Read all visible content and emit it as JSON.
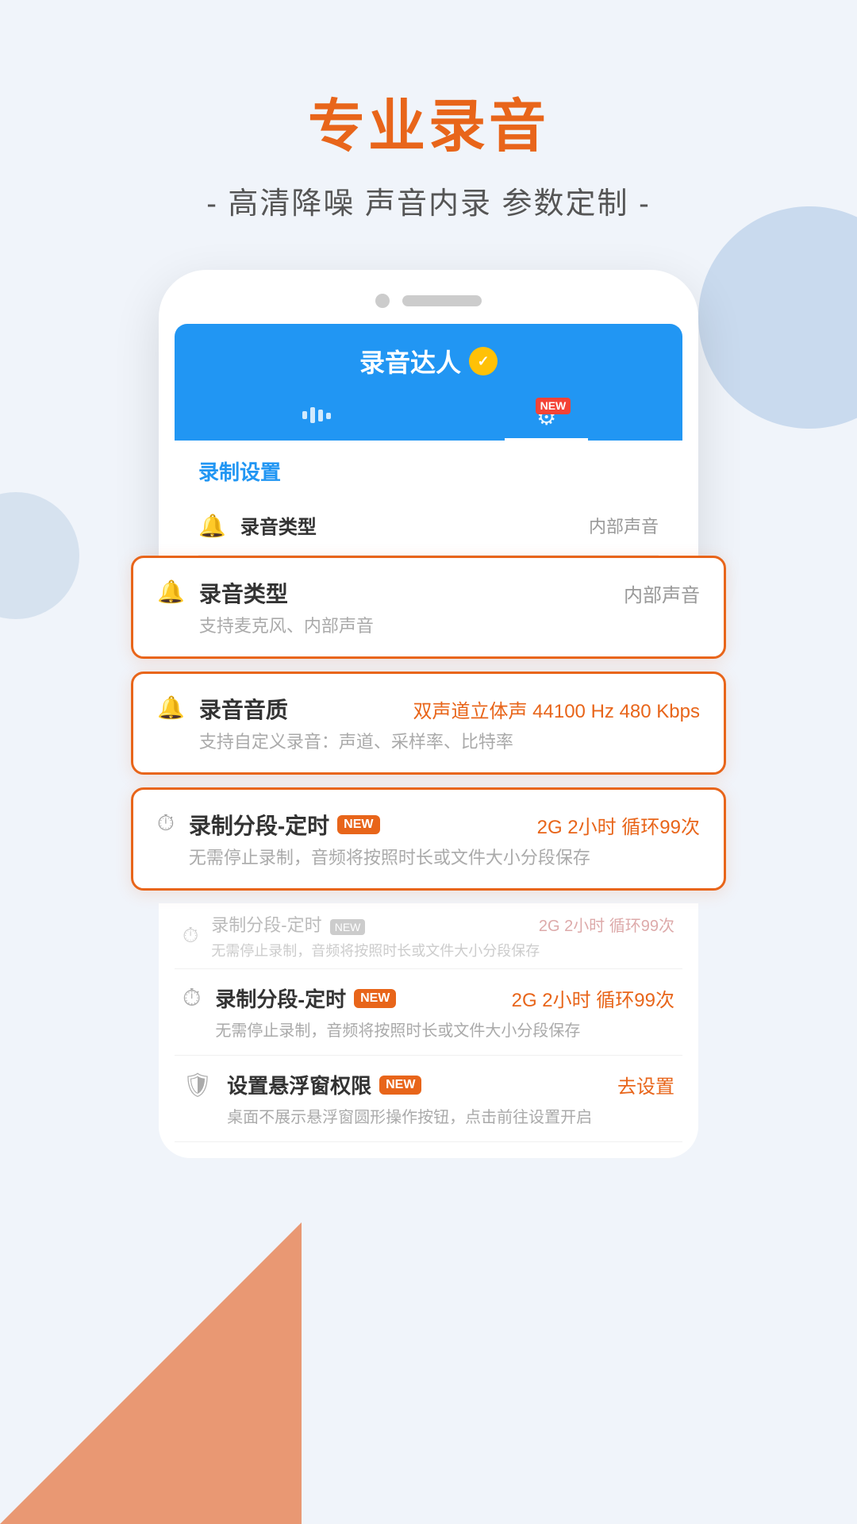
{
  "header": {
    "main_title": "专业录音",
    "sub_title": "- 高清降噪  声音内录  参数定制 -"
  },
  "phone": {
    "app_title": "录音达人",
    "app_badge": "✓",
    "tabs": [
      {
        "id": "waveform",
        "icon": "▌▌▌",
        "active": false
      },
      {
        "id": "settings",
        "icon": "⚙",
        "active": true,
        "new_badge": "NEW"
      }
    ],
    "section_title": "录制设置",
    "settings_preview": [
      {
        "icon": "🔔",
        "label": "录音类型",
        "value": "内部声音",
        "desc": ""
      }
    ]
  },
  "highlighted_cards": [
    {
      "icon": "🔔",
      "label": "录音类型",
      "value": "内部声音",
      "desc": "支持麦克风、内部声音",
      "value_orange": false
    },
    {
      "icon": "🔔",
      "label": "录音音质",
      "value": "双声道立体声 44100 Hz 480 Kbps",
      "desc": "支持自定义录音：声道、采样率、比特率",
      "value_orange": true
    },
    {
      "icon": "⏱",
      "label": "录制分段-定时",
      "has_new_tag": true,
      "value": "2G 2小时 循环99次",
      "desc": "无需停止录制，音频将按照时长或文件大小分段保存",
      "value_orange": true
    }
  ],
  "below_settings": [
    {
      "icon": "⏱",
      "label": "录制分段-定时",
      "has_new_tag": true,
      "value": "2G 2小时 循环99次",
      "desc": "无需停止录制，音频将按照时长或文件大小分段保存"
    },
    {
      "icon": "🛡",
      "label": "设置悬浮窗权限",
      "has_new_tag": true,
      "value": "去设置",
      "desc": "桌面不展示悬浮窗圆形操作按钮，点击前往设置开启"
    }
  ],
  "colors": {
    "orange": "#e8651a",
    "blue": "#2196f3",
    "light_bg": "#f0f4fa"
  }
}
